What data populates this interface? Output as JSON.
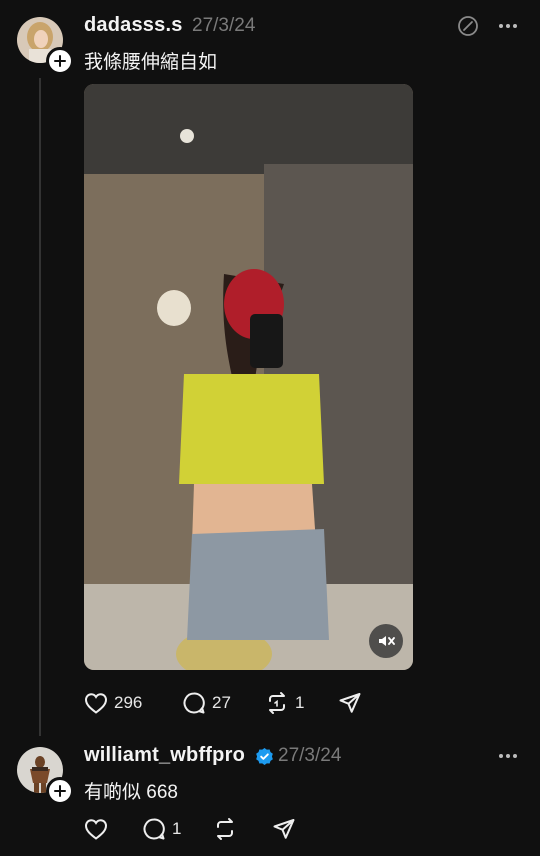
{
  "post": {
    "username": "dadasss.s",
    "date": "27/3/24",
    "text": "我條腰伸縮自如",
    "likes": "296",
    "replies": "27",
    "reposts": "1"
  },
  "reply": {
    "username": "williamt_wbffpro",
    "date": "27/3/24",
    "text": "有啲似 668",
    "replies": "1"
  },
  "icons": {
    "verified": "verified-badge-icon",
    "like": "heart-icon",
    "comment": "comment-icon",
    "repost": "repost-icon",
    "share": "send-icon",
    "more": "more-icon",
    "mute": "mute-icon",
    "options": "circle-slash-icon"
  },
  "colors": {
    "background": "#101010",
    "verified": "#1d9bf0",
    "muted_text": "#7a7a7a"
  }
}
